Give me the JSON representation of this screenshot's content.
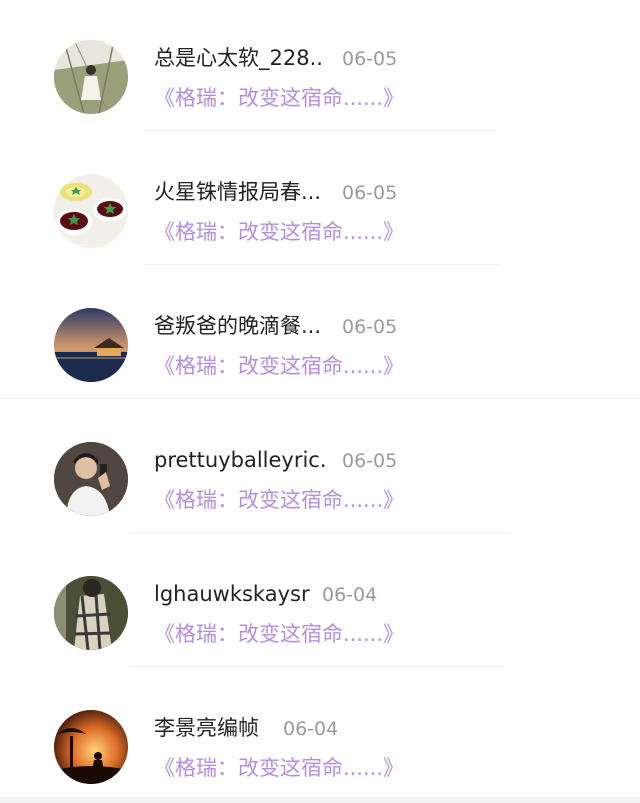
{
  "items": [
    {
      "name": "总是心太软_228..",
      "date": "06-05",
      "book": "《格瑞：改变这宿命......》",
      "avatar_icon": "avatar-girl-outdoors"
    },
    {
      "name": "火星铢情报局春...",
      "date": "06-05",
      "book": "《格瑞：改变这宿命......》",
      "avatar_icon": "avatar-tea-cups"
    },
    {
      "name": "爸叛爸的晚滴餐...",
      "date": "06-05",
      "book": "《格瑞：改变这宿命......》",
      "avatar_icon": "avatar-sunset-villa"
    },
    {
      "name": "prettuyballeyric.",
      "date": "06-05",
      "book": "《格瑞：改变这宿命......》",
      "avatar_icon": "avatar-man-phone"
    },
    {
      "name": "lghauwkskaysr",
      "date": "06-04",
      "book": "《格瑞：改变这宿命......》",
      "avatar_icon": "avatar-plaid-person"
    },
    {
      "name": "李景亮编帧",
      "date": "06-04",
      "book": "《格瑞：改变这宿命......》",
      "avatar_icon": "avatar-sunset-tree"
    }
  ],
  "colors": {
    "name": "#222222",
    "date": "#9b9b9b",
    "book_link": "#b58ee0",
    "divider": "#efefef"
  }
}
